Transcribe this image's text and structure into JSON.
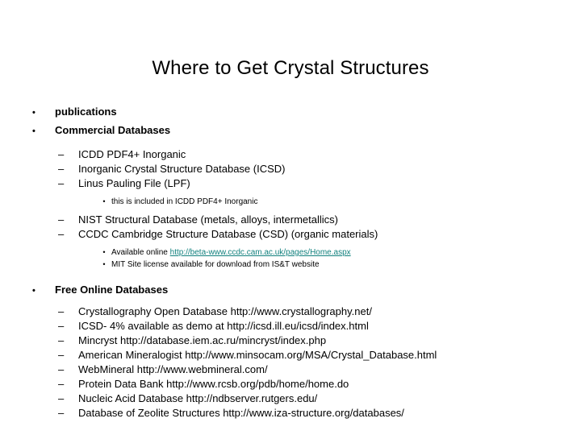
{
  "slide": {
    "title": "Where to Get Crystal Structures",
    "bullet_marker_l1": "•",
    "bullet_marker_l2": "–",
    "bullet_marker_l3": "•",
    "link_color": "#12817e",
    "text_color": "#000000",
    "background_color": "#ffffff",
    "items": {
      "publications": "publications",
      "commercial_databases": "Commercial Databases",
      "icdd_pdf4": "ICDD PDF4+ Inorganic",
      "icsd": "Inorganic Crystal Structure Database (ICSD)",
      "lpf": "Linus Pauling File (LPF)",
      "lpf_note": "this is included in ICDD PDF4+ Inorganic",
      "nist": "NIST Structural Database (metals, alloys, intermetallics)",
      "ccdc": "CCDC Cambridge Structure Database (CSD) (organic materials)",
      "ccdc_available_prefix": "Available online ",
      "ccdc_link": "http://beta-www.ccdc.cam.ac.uk/pages/Home.aspx",
      "ccdc_mit": "MIT Site license available for download from IS&T website",
      "free_online_databases": "Free Online Databases",
      "cod": "Crystallography Open Database http://www.crystallography.net/",
      "icsd_demo": "ICSD- 4% available as demo at http://icsd.ill.eu/icsd/index.html",
      "mincryst": "Mincryst http://database.iem.ac.ru/mincryst/index.php",
      "american_mineralogist": "American Mineralogist http://www.minsocam.org/MSA/Crystal_Database.html",
      "webmineral": "WebMineral http://www.webmineral.com/",
      "pdb": "Protein Data Bank http://www.rcsb.org/pdb/home/home.do",
      "ndb": "Nucleic Acid Database http://ndbserver.rutgers.edu/",
      "zeolite": "Database of Zeolite Structures http://www.iza-structure.org/databases/"
    }
  }
}
